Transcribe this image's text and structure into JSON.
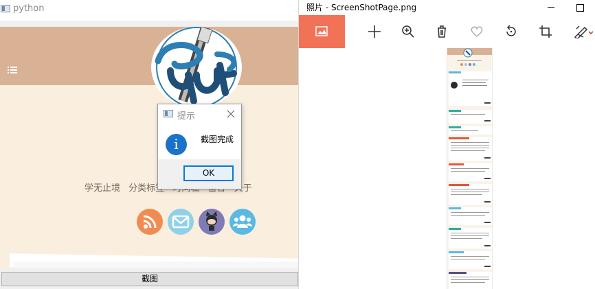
{
  "left_window": {
    "title": "python",
    "nav_links": [
      "学无止境",
      "分类标签",
      "时间轴",
      "留言",
      "关于"
    ],
    "capture_button": "截图"
  },
  "message_box": {
    "title": "提示",
    "message": "截图完成",
    "ok_label": "OK"
  },
  "right_window": {
    "title": "照片 - ScreenShotPage.png"
  },
  "colors": {
    "header": "#d9b295",
    "page_bg": "#faeede",
    "rss": "#f08c52",
    "mail": "#8fd1e8",
    "github": "#7f7bb5",
    "group": "#5ab9e3",
    "photos_accent": "#f27257",
    "info_blue": "#1a73c9"
  },
  "icons": {
    "left_title": "python-window-icon",
    "menu": "hamburger-menu-icon",
    "social": [
      "rss-icon",
      "mail-icon",
      "github-octocat-icon",
      "group-icon"
    ],
    "toolbar": [
      "gallery-icon",
      "add-icon",
      "zoom-in-icon",
      "delete-icon",
      "favorite-icon",
      "rotate-icon",
      "crop-icon",
      "edit-icon"
    ]
  }
}
